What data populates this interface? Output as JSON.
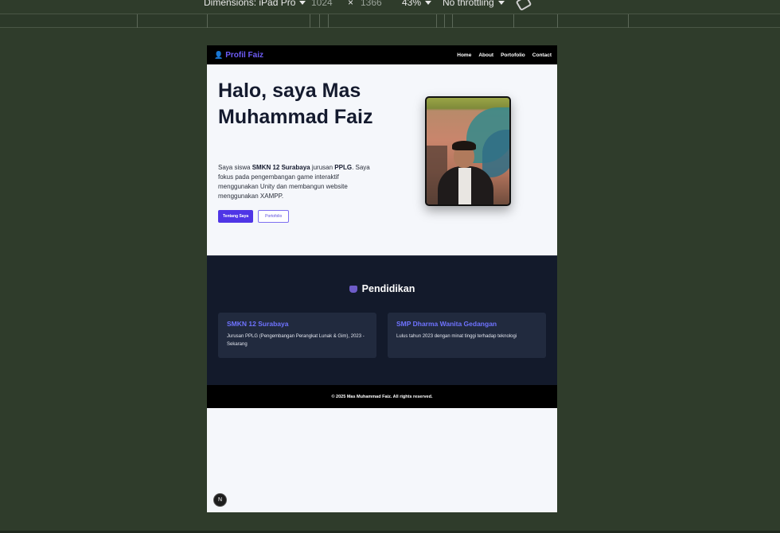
{
  "devtools": {
    "dimensions_label": "Dimensions: iPad Pro",
    "width_value": "1024",
    "times": "×",
    "height_value": "1366",
    "zoom": "43%",
    "throttling": "No throttling"
  },
  "nav": {
    "brand_icon": "👤",
    "brand": "Profil Faiz",
    "links": [
      "Home",
      "About",
      "Portofolio",
      "Contact"
    ]
  },
  "hero": {
    "title": "Halo, saya Mas Muhammad Faiz",
    "desc_pre": "Saya siswa ",
    "desc_school": "SMKN 12 Surabaya",
    "desc_mid": " jurusan ",
    "desc_major": "PPLG",
    "desc_post": ". Saya fokus pada pengembangan game interaktif menggunakan Unity dan membangun website menggunakan XAMPP.",
    "btn_primary": "Tentang Saya",
    "btn_secondary": "Portofolio"
  },
  "education": {
    "title": "Pendidikan",
    "cards": [
      {
        "title": "SMKN 12 Surabaya",
        "text": "Jurusan PPLG (Pengembangan Perangkat Lunak & Gim), 2023 - Sekarang"
      },
      {
        "title": "SMP Dharma Wanita Gedangan",
        "text": "Lulus tahun 2023 dengan minat tinggi terhadap teknologi"
      }
    ]
  },
  "footer": {
    "text": "© 2025 Mas Muhammad Faiz. All rights reserved."
  },
  "badge": {
    "label": "N"
  }
}
